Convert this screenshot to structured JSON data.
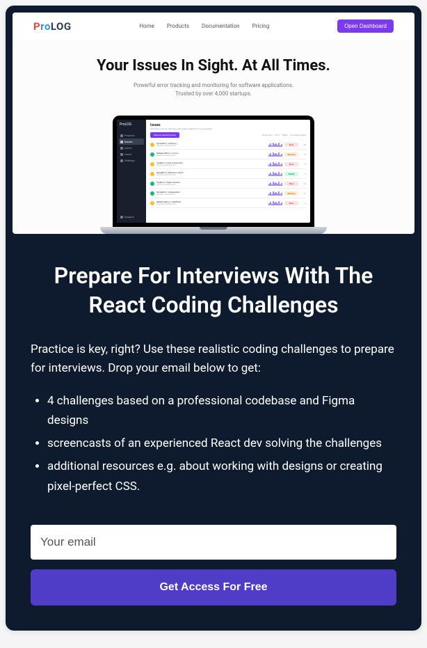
{
  "hero": {
    "logo": {
      "p": "P",
      "ro": "ro",
      "log": "LOG"
    },
    "nav": [
      "Home",
      "Products",
      "Documentation",
      "Pricing"
    ],
    "dashboard_btn": "Open Dashboard",
    "title": "Your Issues In Sight. At All Times.",
    "subtitle_line1": "Powerful error tracking and monitoring for software applications.",
    "subtitle_line2": "Trusted by over 4,000 startups."
  },
  "laptop": {
    "logo": "ProLOG",
    "sidebar": [
      {
        "label": "Projects",
        "active": false
      },
      {
        "label": "Issues",
        "active": true
      },
      {
        "label": "Alerts",
        "active": false
      },
      {
        "label": "Users",
        "active": false
      },
      {
        "label": "Settings",
        "active": false
      }
    ],
    "support": "Support",
    "main_title": "Issues",
    "main_subtitle": "Overview of errors, warnings, and events logged from your projects.",
    "filter_btn": "Resolve selected issues",
    "filters": [
      "Unresolved",
      "Error",
      "Name",
      "Frontend Project"
    ],
    "issues": [
      {
        "dot": "yellow",
        "title": "SyntaxError: missing ) …",
        "desc": "describe something here",
        "badge": "Error",
        "badge_color": "red",
        "count": "25"
      },
      {
        "dot": "green",
        "title": "ReferenceError: x is not…",
        "desc": "describe something here",
        "badge": "Warning",
        "badge_color": "orange",
        "count": "12"
      },
      {
        "dot": "yellow",
        "title": "TypeError: Cannot read prop…",
        "desc": "describe something here",
        "badge": "Error",
        "badge_color": "red",
        "count": "8"
      },
      {
        "dot": "yellow",
        "title": "RangeError: Maximum call st…",
        "desc": "describe something here",
        "badge": "Stable",
        "badge_color": "green",
        "count": "5"
      },
      {
        "dot": "green",
        "title": "TypeError: Object doesn't…",
        "desc": "describe something here",
        "badge": "Error",
        "badge_color": "red",
        "count": "22"
      },
      {
        "dot": "green",
        "title": "SyntaxError: Unexpected…",
        "desc": "describe something here",
        "badge": "Warning",
        "badge_color": "orange",
        "count": "17"
      },
      {
        "dot": "yellow",
        "title": "ReferenceError: undefined…",
        "desc": "describe something here",
        "badge": "Error",
        "badge_color": "red",
        "count": "9"
      }
    ]
  },
  "content": {
    "heading": "Prepare For Interviews With The React Coding Challenges",
    "intro": "Practice is key, right? Use these realistic coding challenges to prepare for interviews. Drop your email below to get:",
    "bullets": [
      "4 challenges based on a professional codebase and Figma designs",
      "screencasts of an experienced React dev solving the challenges",
      "additional resources e.g. about working with designs or creating pixel-perfect CSS."
    ],
    "email_placeholder": "Your email",
    "cta": "Get Access For Free"
  }
}
